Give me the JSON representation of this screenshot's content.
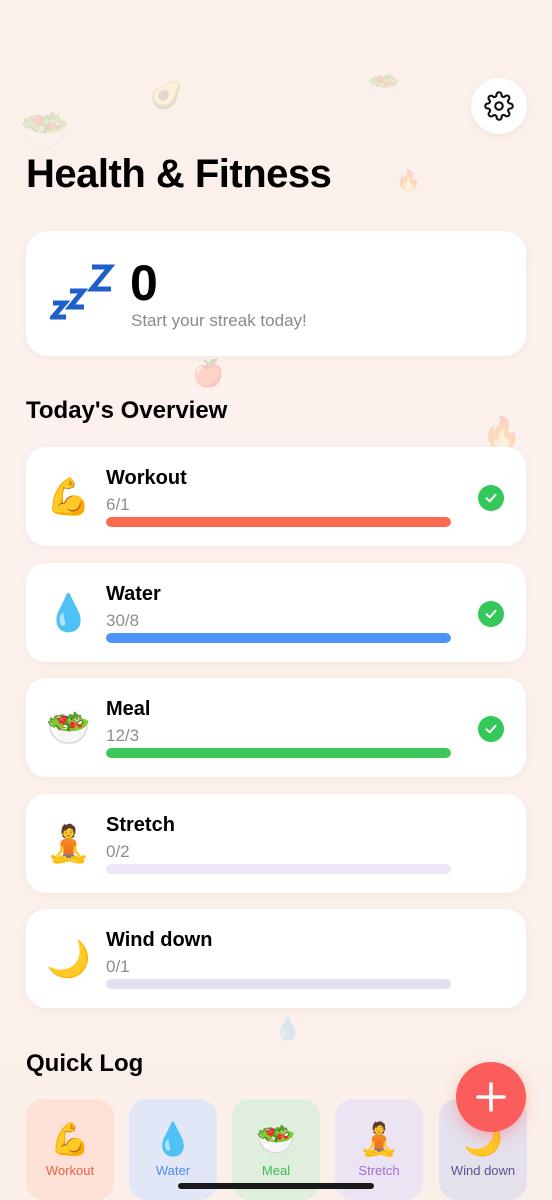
{
  "header": {
    "title": "Health & Fitness",
    "settings_icon": "gear-icon"
  },
  "streak": {
    "icon": "sleep-zzz-icon",
    "count": "0",
    "subtitle": "Start your streak today!"
  },
  "overview": {
    "title": "Today's Overview",
    "goals": [
      {
        "name": "Workout",
        "count": "6/1",
        "emoji": "💪",
        "progress": 1.0,
        "done": true,
        "color": "#fb6a4f",
        "track": "#fde2dc"
      },
      {
        "name": "Water",
        "count": "30/8",
        "emoji": "💧",
        "progress": 1.0,
        "done": true,
        "color": "#4c95f7",
        "track": "#dde9fb"
      },
      {
        "name": "Meal",
        "count": "12/3",
        "emoji": "🥗",
        "progress": 1.0,
        "done": true,
        "color": "#3dc65a",
        "track": "#dcf2e0"
      },
      {
        "name": "Stretch",
        "count": "0/2",
        "emoji": "🧘",
        "progress": 0.0,
        "done": false,
        "color": "#b59ce8",
        "track": "#ece6f6"
      },
      {
        "name": "Wind down",
        "count": "0/1",
        "emoji": "🌙",
        "progress": 0.0,
        "done": false,
        "color": "#9f9acf",
        "track": "#e2e0ef"
      }
    ]
  },
  "quick_log": {
    "title": "Quick Log",
    "items": [
      {
        "label": "Workout",
        "emoji": "💪",
        "bg": "#fde0d6",
        "fg": "#e8624b"
      },
      {
        "label": "Water",
        "emoji": "💧",
        "bg": "#e2e7f7",
        "fg": "#4c8ff0"
      },
      {
        "label": "Meal",
        "emoji": "🥗",
        "bg": "#dfeedd",
        "fg": "#3dbb55"
      },
      {
        "label": "Stretch",
        "emoji": "🧘",
        "bg": "#ece3f3",
        "fg": "#9c6fd6"
      },
      {
        "label": "Wind down",
        "emoji": "🌙",
        "bg": "#e4e0ec",
        "fg": "#5c538f"
      }
    ]
  },
  "fab": {
    "icon": "plus-icon"
  },
  "colors": {
    "accent": "#fb5d5d",
    "success": "#34c759"
  }
}
